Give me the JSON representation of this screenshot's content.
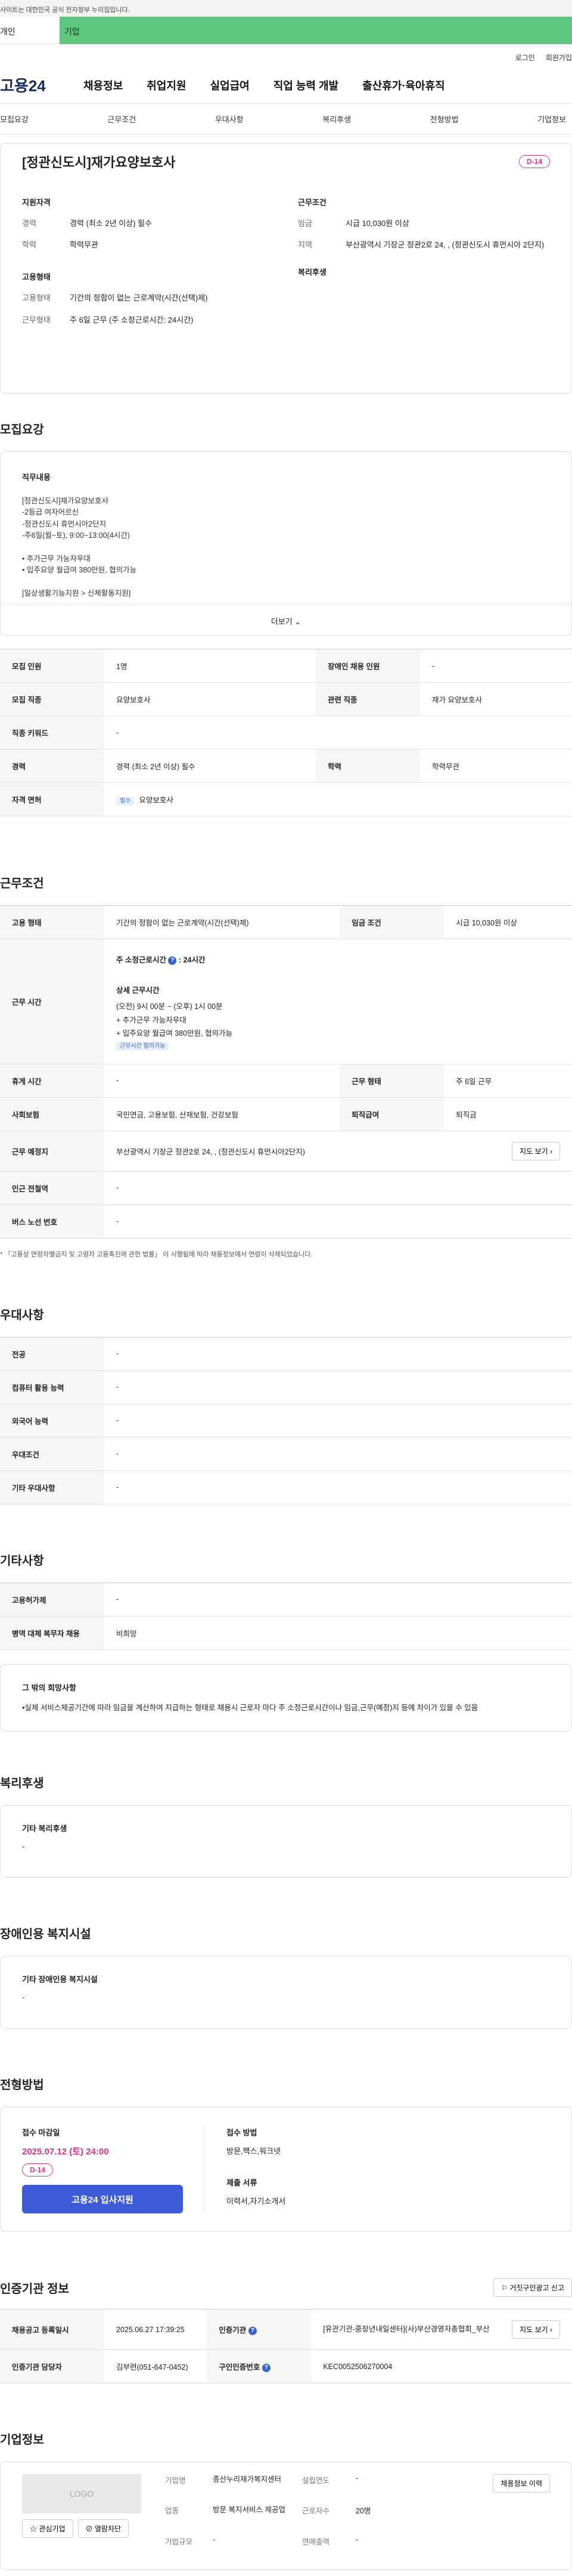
{
  "gov_bar": {
    "text": "사이트는 대한민국 공식 전자정부 누리집입니다."
  },
  "top_tabs": {
    "personal": "개인",
    "company": "기업"
  },
  "util": {
    "login": "로그인",
    "signup": "회원가입"
  },
  "gnb": {
    "logo": "고용24",
    "items": [
      "채용정보",
      "취업지원",
      "실업급여",
      "직업 능력 개발",
      "출산휴가·육아휴직"
    ]
  },
  "subnav": [
    "모집요강",
    "근무조건",
    "우대사항",
    "복리후생",
    "전형방법",
    "기업정보"
  ],
  "summary": {
    "title": "[정관신도시]재가요양보호사",
    "dday": "D-14",
    "qual_heading": "지원자격",
    "qual": [
      {
        "k": "경력",
        "v": "경력 (최소 2년 이상) 필수"
      },
      {
        "k": "학력",
        "v": "학력무관"
      }
    ],
    "work_heading": "근무조건",
    "work": [
      {
        "k": "임금",
        "v": "시급 10,030원 이상"
      },
      {
        "k": "지역",
        "v": "부산광역시 기장군 정관2로 24, , (정관신도시 휴먼시아 2단지)"
      }
    ],
    "emp_heading": "고용형태",
    "emp": [
      {
        "k": "고용형태",
        "v": "기간의 정함이 없는 근로계약(시간(선택)제)"
      },
      {
        "k": "근무형태",
        "v": "주 6일 근무 (주 소정근로시간: 24시간)"
      }
    ],
    "welfare_heading": "복리후생"
  },
  "recruit": {
    "title": "모집요강",
    "duty_heading": "직무내용",
    "duty_lines": [
      "[정관신도시]재가요양보호사",
      "-2등급 여자어르신",
      "-정관신도시 휴먼시아2단지",
      "-주6일(월~토), 9:00~13:00(4시간)",
      "",
      "• 추가근무 가능자우대",
      "• 입주요양 월급여 380만원, 협의가능",
      "",
      "[일상생활기능지원 > 신체활동지원]"
    ],
    "more": "더보기",
    "rows": [
      {
        "k1": "모집 인원",
        "v1": "1명",
        "k2": "장애인 채용 인원",
        "v2": "-"
      },
      {
        "k1": "모집 직종",
        "v1": "요양보호사",
        "k2": "관련 직종",
        "v2": "재가 요양보호사"
      },
      {
        "k1": "직종 키워드",
        "v1": "-"
      },
      {
        "k1": "경력",
        "v1": "경력 (최소 2년 이상) 필수",
        "k2": "학력",
        "v2": "학력무관"
      },
      {
        "k1": "자격 면허",
        "badge": "필수",
        "v1": "요양보호사"
      }
    ]
  },
  "conditions": {
    "title": "근무조건",
    "emp_type_k": "고용 형태",
    "emp_type_v": "기간의 정함이 없는 근로계약(시간(선택)제)",
    "wage_k": "임금 조건",
    "wage_v": "시급 10,030원 이상",
    "hours_k": "근무 시간",
    "weekly_hours": "주 소정근로시간",
    "weekly_hours_val": "24시간",
    "detail_heading": "상세 근무시간",
    "detail_lines": [
      "(오전) 9시 00분 ~ (오후) 1시 00분",
      "+ 추가근무 가능자우대",
      "+ 입주요양 월급여 380만원, 협의가능"
    ],
    "flex_badge": "근무시간 협의가능",
    "rest_k": "휴게 시간",
    "rest_v": "-",
    "form_k": "근무 형태",
    "form_v": "주 6일 근무",
    "insure_k": "사회보험",
    "insure_v": "국민연금, 고용보험, 산재보험, 건강보험",
    "retire_k": "퇴직급여",
    "retire_v": "퇴직금",
    "place_k": "근무 예정지",
    "place_v": "부산광역시 기장군 정관2로 24, , (정관신도시 휴먼시아2단지)",
    "map_btn": "지도 보기",
    "subway_k": "인근 전철역",
    "subway_v": "-",
    "bus_k": "버스 노선 번호",
    "bus_v": "-",
    "note": "* 「고용상 연령차별금지 및 고령자 고용촉진에 관한 법률」 이 시행됨에 따라 채용정보에서 연령이 삭제되었습니다."
  },
  "prefer": {
    "title": "우대사항",
    "rows": [
      {
        "k": "전공",
        "v": "-"
      },
      {
        "k": "컴퓨터 활용 능력",
        "v": "-"
      },
      {
        "k": "외국어 능력",
        "v": "-"
      },
      {
        "k": "우대조건",
        "v": "-"
      },
      {
        "k": "기타 우대사항",
        "v": "-"
      }
    ]
  },
  "etc": {
    "title": "기타사항",
    "rows": [
      {
        "k": "고용허가제",
        "v": "-"
      },
      {
        "k": "병역 대체 복무자 채용",
        "v": "비희망"
      }
    ],
    "wish_heading": "그 밖의 희망사항",
    "wish_text": "•실제 서비스제공기간에 따라 임금을 계산하여 지급하는 형태로 채용시 근로자 마다 주 소정근로시간이나 임금,근무(예정)지 등에 차이가 있을 수 있음"
  },
  "welfare": {
    "title": "복리후생",
    "heading": "기타 복리후생",
    "value": "-"
  },
  "disabled": {
    "title": "장애인용 복지시설",
    "heading": "기타 장애인용 복지시설",
    "value": "-"
  },
  "process": {
    "title": "전형방법",
    "deadline_heading": "접수 마감일",
    "deadline": "2025.07.12 (토) 24:00",
    "dday": "D-14",
    "apply_btn": "고용24 입사지원",
    "method_heading": "접수 방법",
    "method": "방문,팩스,워크넷",
    "docs_heading": "제출 서류",
    "docs": "이력서,자기소개서"
  },
  "cert": {
    "title": "인증기관 정보",
    "report_btn": "거짓구인광고 신고",
    "reg_k": "채용공고 등록일시",
    "reg_v": "2025.06.27 17:39:25",
    "org_k": "인증기관",
    "org_v": "[유관기관-중장년내일센터](사)부산경영자총협회_부산",
    "map_btn": "지도 보기",
    "mgr_k": "인증기관 담당자",
    "mgr_v": "김부련(051-647-0452)",
    "num_k": "구인인증번호",
    "num_v": "KEC0052506270004"
  },
  "company": {
    "title": "기업정보",
    "logo_text": "LOGO",
    "interest_btn": "관심기업",
    "block_btn": "열람차단",
    "name_k": "기업명",
    "name_v": "종산누리재가복지센터",
    "industry_k": "업종",
    "industry_v": "방문 복지서비스 제공업",
    "size_k": "기업규모",
    "size_v": "-",
    "found_k": "설립연도",
    "found_v": "-",
    "sales_k": "연매출액",
    "sales_v": "-",
    "emp_k": "근로자수",
    "emp_v": "20명",
    "jobs_btn": "채용정보 이력"
  },
  "colors": {
    "accent": "#3f5bd8",
    "dday": "#d63384",
    "topbar_green": "#5ec77f"
  }
}
